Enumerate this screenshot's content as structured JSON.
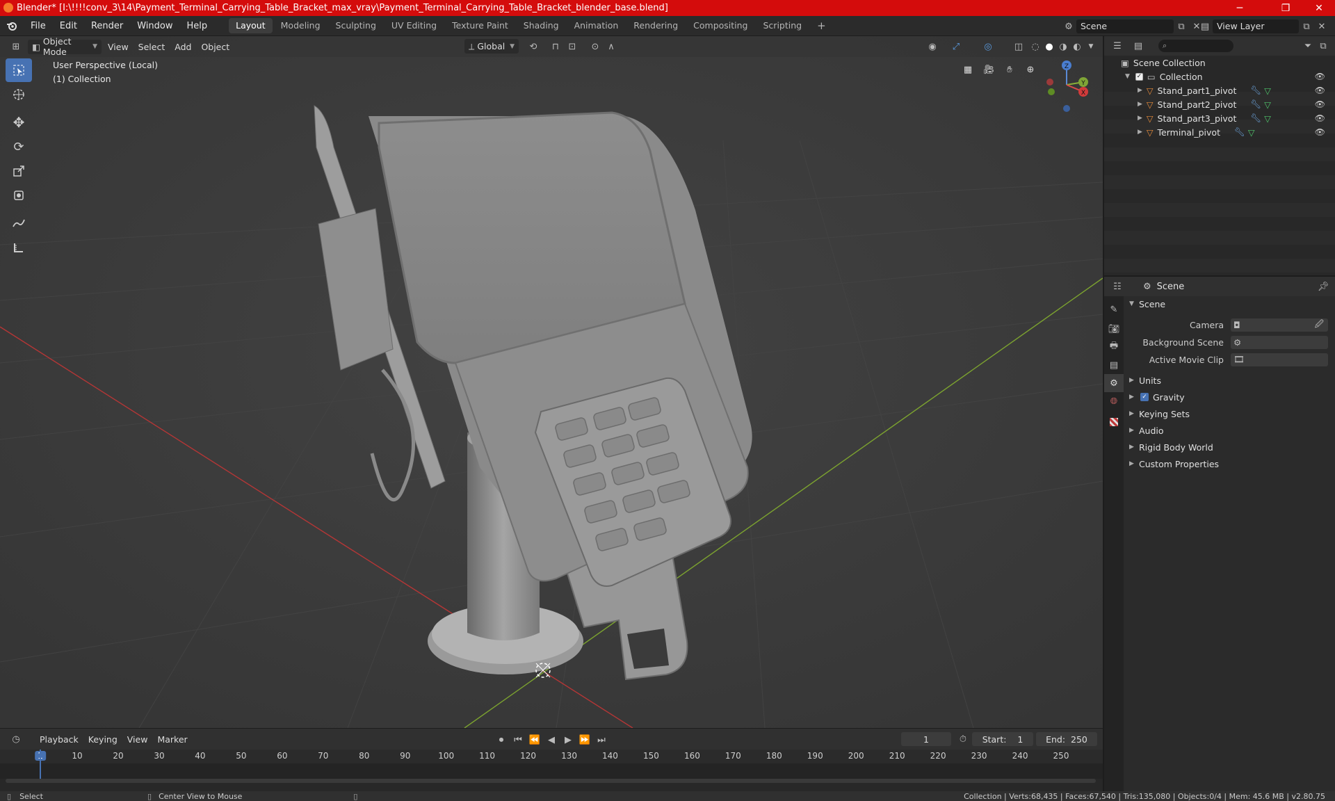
{
  "window": {
    "title": "Blender* [I:\\!!!!conv_3\\14\\Payment_Terminal_Carrying_Table_Bracket_max_vray\\Payment_Terminal_Carrying_Table_Bracket_blender_base.blend]",
    "minimize": "─",
    "maximize": "❐",
    "close": "✕"
  },
  "menus": [
    "File",
    "Edit",
    "Render",
    "Window",
    "Help"
  ],
  "workspaces": [
    "Layout",
    "Modeling",
    "Sculpting",
    "UV Editing",
    "Texture Paint",
    "Shading",
    "Animation",
    "Rendering",
    "Compositing",
    "Scripting"
  ],
  "workspace_add": "+",
  "scene_field": "Scene",
  "view_layer_field": "View Layer",
  "viewport": {
    "mode": "Object Mode",
    "menus": [
      "View",
      "Select",
      "Add",
      "Object"
    ],
    "transform_orientation": "Global",
    "info_line1": "User Perspective (Local)",
    "info_line2": "(1) Collection",
    "gizmo": {
      "z": "Z",
      "y": "Y",
      "x": "X"
    }
  },
  "outliner": {
    "search_placeholder": "",
    "root": "Scene Collection",
    "collection": "Collection",
    "items": [
      "Stand_part1_pivot",
      "Stand_part2_pivot",
      "Stand_part3_pivot",
      "Terminal_pivot"
    ]
  },
  "properties": {
    "context": "Scene",
    "section": "Scene",
    "camera_label": "Camera",
    "background_scene_label": "Background Scene",
    "active_movie_clip_label": "Active Movie Clip",
    "panels": [
      "Units",
      "Gravity",
      "Keying Sets",
      "Audio",
      "Rigid Body World",
      "Custom Properties"
    ]
  },
  "timeline": {
    "menus": [
      "Playback",
      "Keying",
      "View",
      "Marker"
    ],
    "current_frame": "1",
    "start_label": "Start:",
    "start": "1",
    "end_label": "End:",
    "end": "250",
    "ticks": [
      "1",
      "10",
      "20",
      "30",
      "40",
      "50",
      "60",
      "70",
      "80",
      "90",
      "100",
      "110",
      "120",
      "130",
      "140",
      "150",
      "160",
      "170",
      "180",
      "190",
      "200",
      "210",
      "220",
      "230",
      "240",
      "250"
    ]
  },
  "status": {
    "select": "Select",
    "center_view": "Center View to Mouse",
    "stats": "Collection | Verts:68,435 | Faces:67,540 | Tris:135,080 | Objects:0/4 | Mem: 45.6 MB | v2.80.75"
  }
}
